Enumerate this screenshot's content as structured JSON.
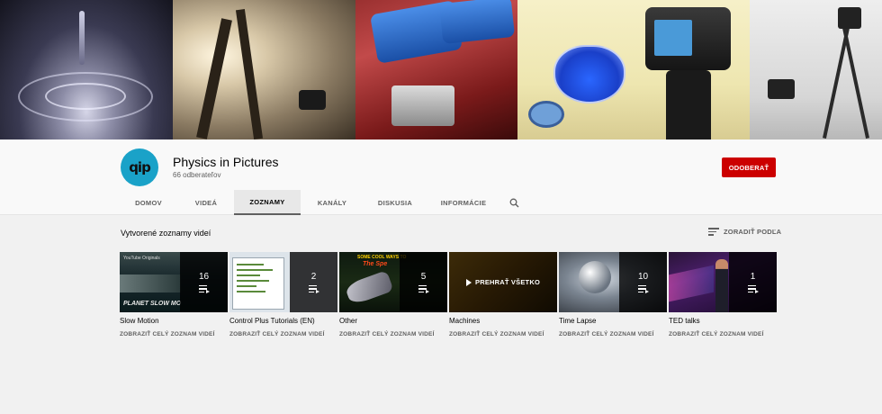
{
  "channel": {
    "name": "Physics in Pictures",
    "subscribers": "66 odberateľov",
    "avatar_text": "qip",
    "subscribe_label": "ODOBERAŤ"
  },
  "tabs": [
    {
      "label": "DOMOV",
      "active": false
    },
    {
      "label": "VIDEÁ",
      "active": false
    },
    {
      "label": "ZOZNAMY",
      "active": true
    },
    {
      "label": "KANÁLY",
      "active": false
    },
    {
      "label": "DISKUSIA",
      "active": false
    },
    {
      "label": "INFORMÁCIE",
      "active": false
    }
  ],
  "search_icon": "search-icon",
  "section": {
    "title": "Vytvorené zoznamy videí",
    "sort_label": "ZORADIŤ PODĽA"
  },
  "playlists": [
    {
      "title": "Slow Motion",
      "count": "16",
      "link": "ZOBRAZIŤ CELÝ ZOZNAM VIDEÍ",
      "thumb_brand": "YouTube Originals",
      "thumb_text": "PLANET SLOW MO"
    },
    {
      "title": "Control Plus Tutorials (EN)",
      "count": "2",
      "link": "ZOBRAZIŤ CELÝ ZOZNAM VIDEÍ"
    },
    {
      "title": "Other",
      "count": "5",
      "link": "ZOBRAZIŤ CELÝ ZOZNAM VIDEÍ",
      "thumb_text_1": "SOME COOL WAYS TO",
      "thumb_text_2": "The Spe"
    },
    {
      "title": "Machines",
      "count": "",
      "link": "ZOBRAZIŤ CELÝ ZOZNAM VIDEÍ",
      "play_all": "PREHRAŤ VŠETKO"
    },
    {
      "title": "Time Lapse",
      "count": "10",
      "link": "ZOBRAZIŤ CELÝ ZOZNAM VIDEÍ"
    },
    {
      "title": "TED talks",
      "count": "1",
      "link": "ZOBRAZIŤ CELÝ ZOZNAM VIDEÍ"
    }
  ],
  "colors": {
    "subscribe": "#cc0000",
    "avatar": "#1aa2c8",
    "background": "#f1f1f1"
  }
}
